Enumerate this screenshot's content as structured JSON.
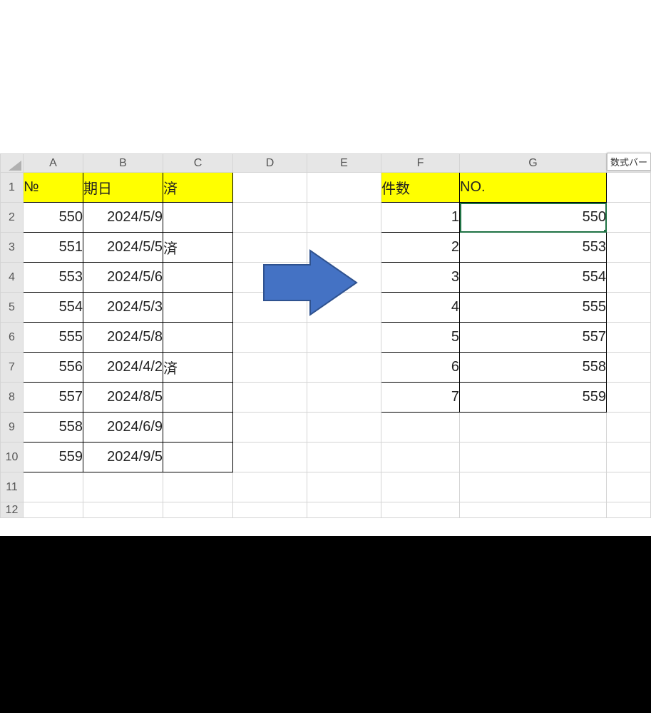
{
  "columns": [
    "A",
    "B",
    "C",
    "D",
    "E",
    "F",
    "G"
  ],
  "leftTable": {
    "headers": {
      "no": "№",
      "date": "期日",
      "done": "済"
    },
    "rows": [
      {
        "no": "550",
        "date": "2024/5/9",
        "done": ""
      },
      {
        "no": "551",
        "date": "2024/5/5",
        "done": "済"
      },
      {
        "no": "553",
        "date": "2024/5/6",
        "done": ""
      },
      {
        "no": "554",
        "date": "2024/5/3",
        "done": ""
      },
      {
        "no": "555",
        "date": "2024/5/8",
        "done": ""
      },
      {
        "no": "556",
        "date": "2024/4/2",
        "done": "済"
      },
      {
        "no": "557",
        "date": "2024/8/5",
        "done": ""
      },
      {
        "no": "558",
        "date": "2024/6/9",
        "done": ""
      },
      {
        "no": "559",
        "date": "2024/9/5",
        "done": ""
      }
    ]
  },
  "rightTable": {
    "headers": {
      "count": "件数",
      "no": "NO."
    },
    "rows": [
      {
        "count": "1",
        "no": "550"
      },
      {
        "count": "2",
        "no": "553"
      },
      {
        "count": "3",
        "no": "554"
      },
      {
        "count": "4",
        "no": "555"
      },
      {
        "count": "5",
        "no": "557"
      },
      {
        "count": "6",
        "no": "558"
      },
      {
        "count": "7",
        "no": "559"
      }
    ]
  },
  "rowNumbers": [
    "1",
    "2",
    "3",
    "4",
    "5",
    "6",
    "7",
    "8",
    "9",
    "10",
    "11",
    "12"
  ],
  "formulaChip": "数式バー"
}
